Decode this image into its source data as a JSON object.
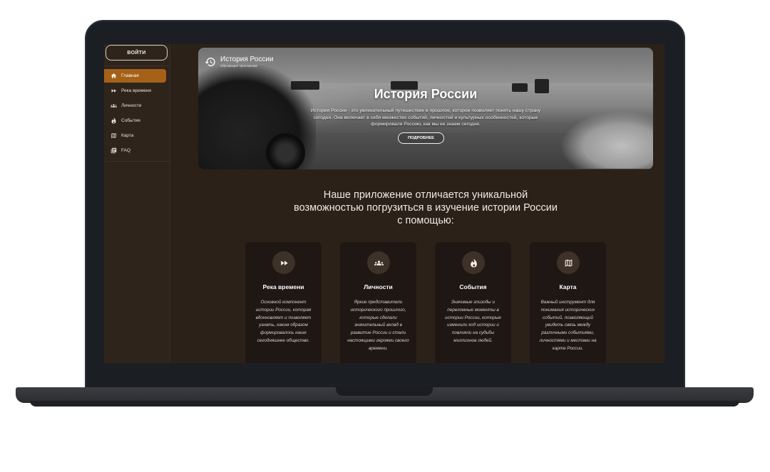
{
  "sidebar": {
    "login_label": "ВОЙТИ",
    "items": [
      {
        "label": "Главная",
        "icon": "home-icon",
        "active": true
      },
      {
        "label": "Река времени",
        "icon": "fast-forward-icon",
        "active": false
      },
      {
        "label": "Личности",
        "icon": "people-icon",
        "active": false
      },
      {
        "label": "События",
        "icon": "flame-icon",
        "active": false
      },
      {
        "label": "Карта",
        "icon": "map-icon",
        "active": false
      },
      {
        "label": "FAQ",
        "icon": "book-icon",
        "active": false
      }
    ]
  },
  "hero": {
    "brand_title": "История России",
    "brand_subtitle": "Обучающее приложение",
    "title": "История России",
    "description": "История России - это увлекательный путешествие в прошлое, которое позволяет понять нашу страну сегодня. Она включает в себя множество событий, личностей и культурных особенностей, которые формировали Россию, как мы ее знаем сегодня.",
    "button_label": "ПОДРОБНЕЕ"
  },
  "section": {
    "title_line1": "Наше приложение отличается уникальной",
    "title_line2": "возможностью погрузиться в изучение истории России",
    "title_line3": "с помощью:"
  },
  "cards": [
    {
      "icon": "fast-forward-icon",
      "title": "Река времени",
      "text": "Основной компонент истории России, которая вдохновляет и позволяет узнать, каким образом формировалось наше сегодняшнее общество."
    },
    {
      "icon": "people-icon",
      "title": "Личности",
      "text": "Яркие представители исторического прошлого, которые сделали значительный вклад в развитие России и стали настоящими героями своего времени."
    },
    {
      "icon": "flame-icon",
      "title": "События",
      "text": "Значимые эпизоды и переломные моменты в истории России, которые изменили ход истории и повлияли на судьбы миллионов людей."
    },
    {
      "icon": "map-icon",
      "title": "Карта",
      "text": "Важный инструмент для понимания исторических событий, позволяющий увидеть связь между различными событиями, личностями и местами на карте России."
    }
  ],
  "colors": {
    "accent": "#a66118",
    "background": "#2b2119",
    "sidebar": "#2f241c",
    "card": "#1e1713"
  }
}
